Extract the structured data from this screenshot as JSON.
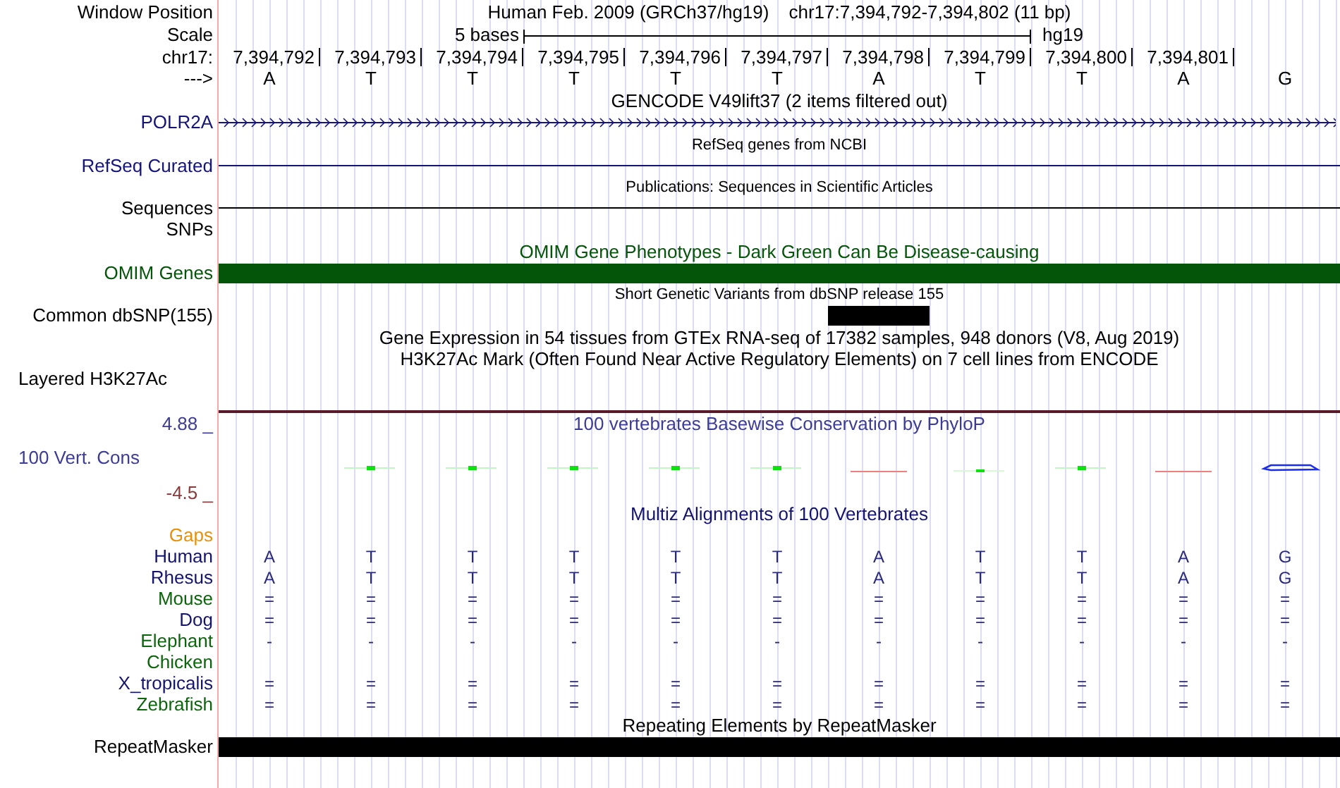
{
  "position": {
    "label": "Window Position",
    "assembly": "Human Feb. 2009 (GRCh37/hg19)",
    "range": "chr17:7,394,792-7,394,802 (11 bp)"
  },
  "scale": {
    "label": "Scale",
    "span": "5 bases",
    "assembly": "hg19"
  },
  "ruler": {
    "label": "chr17:",
    "positions": [
      "7,394,792",
      "7,394,793",
      "7,394,794",
      "7,394,795",
      "7,394,796",
      "7,394,797",
      "7,394,798",
      "7,394,799",
      "7,394,800",
      "7,394,801"
    ]
  },
  "bases": {
    "label": "--->",
    "letters": [
      "A",
      "T",
      "T",
      "T",
      "T",
      "T",
      "A",
      "T",
      "T",
      "A",
      "G"
    ]
  },
  "tracks": [
    {
      "kind": "gene",
      "title": "GENCODE V49lift37 (2 items filtered out)",
      "label": "POLR2A",
      "color": "#14147a"
    },
    {
      "kind": "line",
      "title": "RefSeq genes from NCBI",
      "label": "RefSeq Curated",
      "color": "#14147a"
    },
    {
      "kind": "line",
      "title": "Publications: Sequences in Scientific Articles",
      "label": "Sequences",
      "color": "#000000"
    },
    {
      "kind": "label",
      "label": "SNPs",
      "color": "#000000"
    },
    {
      "kind": "bar",
      "title": "OMIM Gene Phenotypes - Dark Green Can Be Disease-causing",
      "label": "OMIM Genes",
      "color": "#04540a"
    },
    {
      "kind": "blocks",
      "title": "Short Genetic Variants from dbSNP release 155",
      "label": "Common dbSNP(155)",
      "color": "#000000",
      "marked": [
        false,
        false,
        false,
        false,
        false,
        false,
        true,
        false,
        false,
        false,
        false
      ]
    },
    {
      "kind": "text",
      "title": "Gene Expression in 54 tissues from GTEx RNA-seq of 17382 samples, 948 donors (V8, Aug 2019)"
    },
    {
      "kind": "layered",
      "title": "H3K27Ac Mark (Often Found Near Active Regulatory Elements) on 7 cell lines from ENCODE",
      "label": "Layered H3K27Ac",
      "color": "#000000"
    },
    {
      "kind": "wiggle",
      "title": "100 vertebrates Basewise Conservation by PhyloP",
      "label": "100 Vert. Cons",
      "color": "#3c3c96",
      "max": "4.88 _",
      "min": "-4.5 _"
    },
    {
      "kind": "alignment",
      "title": "Multiz Alignments of 100 Vertebrates",
      "color": "#14146e",
      "species": [
        {
          "name": "Gaps",
          "color": "#e8900a"
        },
        {
          "name": "Human",
          "color": "#14146e",
          "cells": [
            "A",
            "T",
            "T",
            "T",
            "T",
            "T",
            "A",
            "T",
            "T",
            "A",
            "G"
          ]
        },
        {
          "name": "Rhesus",
          "color": "#14146e",
          "cells": [
            "A",
            "T",
            "T",
            "T",
            "T",
            "T",
            "A",
            "T",
            "T",
            "A",
            "G"
          ]
        },
        {
          "name": "Mouse",
          "color": "#0b650b",
          "cells": [
            "=",
            "=",
            "=",
            "=",
            "=",
            "=",
            "=",
            "=",
            "=",
            "=",
            "="
          ]
        },
        {
          "name": "Dog",
          "color": "#14146e",
          "cells": [
            "=",
            "=",
            "=",
            "=",
            "=",
            "=",
            "=",
            "=",
            "=",
            "=",
            "="
          ]
        },
        {
          "name": "Elephant",
          "color": "#0b650b",
          "cells": [
            "-",
            "-",
            "-",
            "-",
            "-",
            "-",
            "-",
            "-",
            "-",
            "-",
            "-"
          ]
        },
        {
          "name": "Chicken",
          "color": "#0b650b"
        },
        {
          "name": "X_tropicalis",
          "color": "#14146e",
          "cells": [
            "=",
            "=",
            "=",
            "=",
            "=",
            "=",
            "=",
            "=",
            "=",
            "=",
            "="
          ]
        },
        {
          "name": "Zebrafish",
          "color": "#0b650b",
          "cells": [
            "=",
            "=",
            "=",
            "=",
            "=",
            "=",
            "=",
            "=",
            "=",
            "=",
            "="
          ]
        }
      ]
    },
    {
      "kind": "bar",
      "title": "Repeating Elements by RepeatMasker",
      "label": "RepeatMasker",
      "color": "#000000"
    }
  ]
}
